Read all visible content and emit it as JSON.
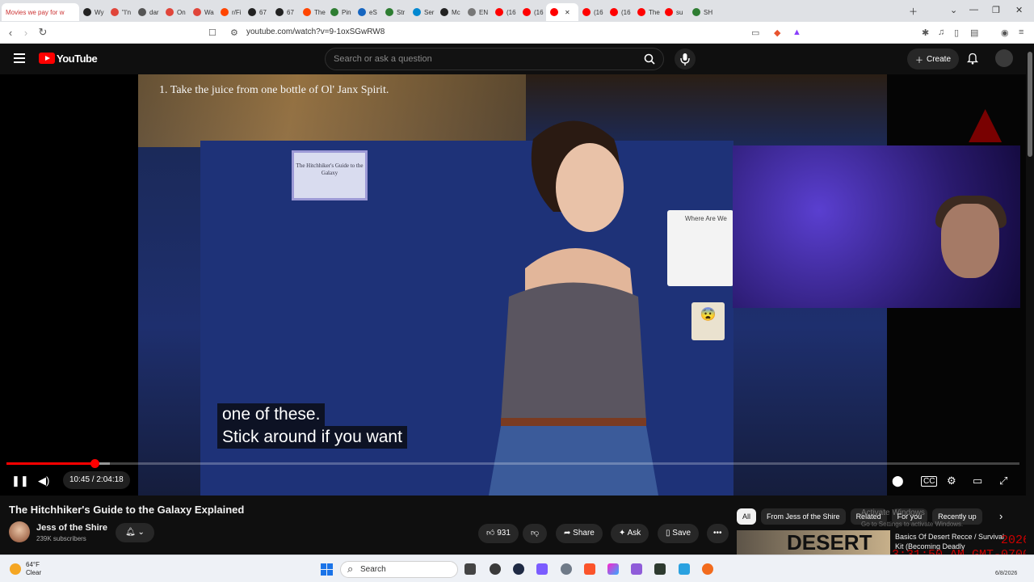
{
  "browser": {
    "tabs": [
      {
        "label": "Movies we pay for w",
        "color": "#e5e7ea"
      },
      {
        "label": "Wy",
        "color": "#222222"
      },
      {
        "label": "\"I'n",
        "color": "#e0453a"
      },
      {
        "label": "dar",
        "color": "#555555"
      },
      {
        "label": "On",
        "color": "#e0453a"
      },
      {
        "label": "Wa",
        "color": "#e0453a"
      },
      {
        "label": "r/Fi",
        "color": "#ff4500"
      },
      {
        "label": "67",
        "color": "#222222"
      },
      {
        "label": "67",
        "color": "#222222"
      },
      {
        "label": "The",
        "color": "#ff4500"
      },
      {
        "label": "Pin",
        "color": "#2e7d32"
      },
      {
        "label": "eS",
        "color": "#1565c0"
      },
      {
        "label": "Str",
        "color": "#2e7d32"
      },
      {
        "label": "Ser",
        "color": "#0288d1"
      },
      {
        "label": "Mc",
        "color": "#222222"
      },
      {
        "label": "EN",
        "color": "#777777"
      },
      {
        "label": "(16",
        "color": "#ff0000"
      },
      {
        "label": "(16",
        "color": "#ff0000"
      },
      {
        "label": "",
        "color": "#ff0000"
      },
      {
        "label": "(16",
        "color": "#ff0000"
      },
      {
        "label": "(16",
        "color": "#ff0000"
      },
      {
        "label": "The",
        "color": "#ff0000"
      },
      {
        "label": "su",
        "color": "#ff0000"
      },
      {
        "label": "SH",
        "color": "#2e7d32"
      }
    ],
    "url": "youtube.com/watch?v=9-1oxSGwRW8"
  },
  "header": {
    "logo_text": "YouTube",
    "search_placeholder": "Search or ask a question",
    "create_label": "Create"
  },
  "video": {
    "top_overlay_text": "1. Take the juice from one bottle of Ol' Janx Spirit.",
    "poster_text": "The Hitchhiker's Guide to the Galaxy",
    "whiteboard_text": "Where Are We",
    "emoji_card": "😨",
    "caption_line1": "one of these.",
    "caption_line2": "Stick around if you want",
    "played_fraction": 0.087,
    "buffered_fraction": 0.102,
    "time_display": "10:45 / 2:04:18"
  },
  "below": {
    "title": "The Hitchhiker's Guide to the Galaxy Explained",
    "channel_name": "Jess of the Shire",
    "subscribers": "239K subscribers",
    "likes": "931",
    "share_label": "Share",
    "ask_label": "Ask",
    "save_label": "Save",
    "chips": [
      "All",
      "From Jess of the Shire",
      "Related",
      "For you",
      "Recently up"
    ],
    "recommendation_thumb_text": "DESERT",
    "recommendation_title": "Basics Of Desert Recce / Survival Kit (Becoming Deadly",
    "activate_line1": "Activate Windows",
    "activate_line2": "Go to Settings to activate Windows."
  },
  "overlay_clock": {
    "line1": "2026",
    "line2": "3:31:50 AM GMT-0700"
  },
  "taskbar": {
    "temperature": "64°F",
    "condition": "Clear",
    "search_label": "Search",
    "date": "6/8/2026"
  }
}
